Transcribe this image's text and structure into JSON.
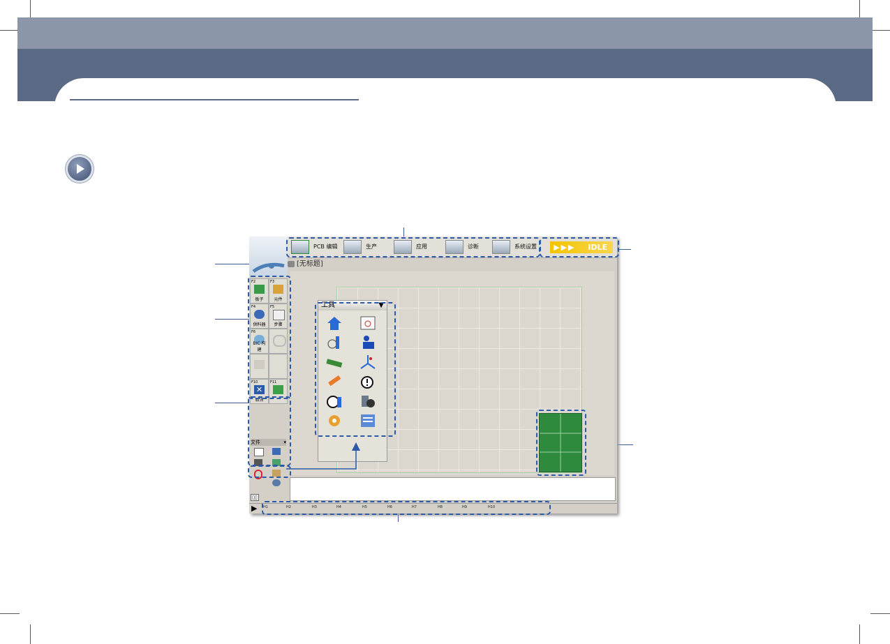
{
  "app": {
    "menu": [
      {
        "label": "PCB 编辑",
        "icon": "pcb-edit-icon"
      },
      {
        "label": "生产",
        "icon": "production-icon"
      },
      {
        "label": "应用",
        "icon": "application-icon"
      },
      {
        "label": "诊断",
        "icon": "diagnosis-icon"
      },
      {
        "label": "系统设置",
        "icon": "system-settings-icon"
      }
    ],
    "status": {
      "arrows": "▶▶▶",
      "text": "IDLE",
      "color": "#f5c400"
    },
    "doc_title": "[无标题]",
    "fkeys": [
      {
        "key": "F2",
        "label": "板子"
      },
      {
        "key": "F3",
        "label": "元件"
      },
      {
        "key": "F4",
        "label": "供料器"
      },
      {
        "key": "F5",
        "label": "步骤"
      },
      {
        "key": "F6",
        "label": "BIC 构建"
      },
      {
        "key": "",
        "label": ""
      },
      {
        "key": "",
        "label": ""
      },
      {
        "key": "",
        "label": ""
      },
      {
        "key": "F10",
        "label": "取消"
      },
      {
        "key": "F11",
        "label": ""
      }
    ],
    "file_panel_label": "文件",
    "tool_panel_label": "工具",
    "toolbox_title": "工具",
    "status_cells": [
      "H1",
      "H2",
      "H3",
      "H4",
      "H5",
      "H6",
      "H7",
      "H8",
      "H9",
      "H10"
    ],
    "bottom_label": "▯▯"
  }
}
